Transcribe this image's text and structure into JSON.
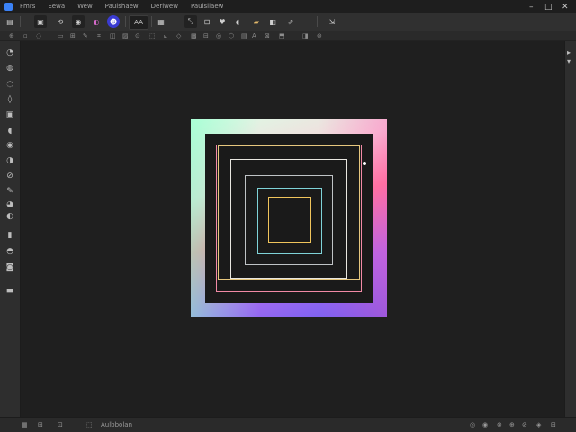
{
  "menubar": {
    "app_icon": "app-logo-icon",
    "menus": [
      "Fmrs",
      "Eewa",
      "Wew",
      "Paulshaew",
      "Deriwew",
      "Paulsilaew"
    ],
    "window_controls": [
      "–",
      "□",
      "✕"
    ]
  },
  "toolbar": {
    "buttons": [
      {
        "name": "new-file-icon",
        "glyph": "▤"
      },
      {
        "name": "image-icon",
        "glyph": "▣"
      },
      {
        "name": "rotate-icon",
        "glyph": "⟲"
      },
      {
        "name": "camera-icon",
        "glyph": "◉"
      },
      {
        "name": "color-picker-icon",
        "glyph": "◐"
      },
      {
        "name": "profile-icon",
        "glyph": "☻"
      },
      {
        "name": "aa-toggle",
        "glyph": "AA"
      },
      {
        "name": "grid-icon",
        "glyph": "▦"
      },
      {
        "name": "transform-icon",
        "glyph": "⤡"
      },
      {
        "name": "crop-icon",
        "glyph": "⊡"
      },
      {
        "name": "favorite-icon",
        "glyph": "♥"
      },
      {
        "name": "speech-icon",
        "glyph": "◖"
      },
      {
        "name": "layers-icon",
        "glyph": "▰"
      },
      {
        "name": "mask-icon",
        "glyph": "◧"
      },
      {
        "name": "share-icon",
        "glyph": "⇗"
      },
      {
        "name": "export-icon",
        "glyph": "⇲"
      }
    ],
    "aa_label": "AA"
  },
  "optbar": {
    "items": [
      "⊕",
      "▫",
      "◌",
      "▭",
      "⊞",
      "✎",
      "⌗",
      "◫",
      "▨",
      "⊙",
      "⬚",
      "⟀",
      "◇",
      "▩",
      "⊟",
      "◎",
      "⬡",
      "▤",
      "A",
      "⊠",
      "⬒",
      "◨",
      "⊛"
    ]
  },
  "tools": [
    {
      "name": "move-tool-icon",
      "glyph": "◔"
    },
    {
      "name": "lasso-tool-icon",
      "glyph": "◍"
    },
    {
      "name": "magic-wand-icon",
      "glyph": "◌"
    },
    {
      "name": "crop-tool-icon",
      "glyph": "◊"
    },
    {
      "name": "frame-tool-icon",
      "glyph": "▣"
    },
    {
      "name": "eyedropper-icon",
      "glyph": "◖"
    },
    {
      "name": "heal-tool-icon",
      "glyph": "◉"
    },
    {
      "name": "brush-tool-icon",
      "glyph": "◑"
    },
    {
      "name": "stamp-tool-icon",
      "glyph": "⊘"
    },
    {
      "name": "pen-tool-icon",
      "glyph": "✎"
    },
    {
      "name": "eraser-tool-icon",
      "glyph": "◕"
    },
    {
      "name": "gradient-tool-icon",
      "glyph": "◐"
    },
    {
      "name": "blur-tool-icon",
      "glyph": "▮"
    },
    {
      "name": "dodge-tool-icon",
      "glyph": "◓"
    },
    {
      "name": "text-tool-icon",
      "glyph": "◙"
    },
    {
      "name": "shape-tool-icon",
      "glyph": "▬"
    }
  ],
  "statusbar": {
    "left": [
      "▦",
      "⊞",
      "⊡",
      "⬚"
    ],
    "doc_info": "Aulbbolan",
    "right": [
      "◎",
      "◉",
      "⊗",
      "⊕",
      "⊘",
      "◈",
      "⊟"
    ]
  }
}
